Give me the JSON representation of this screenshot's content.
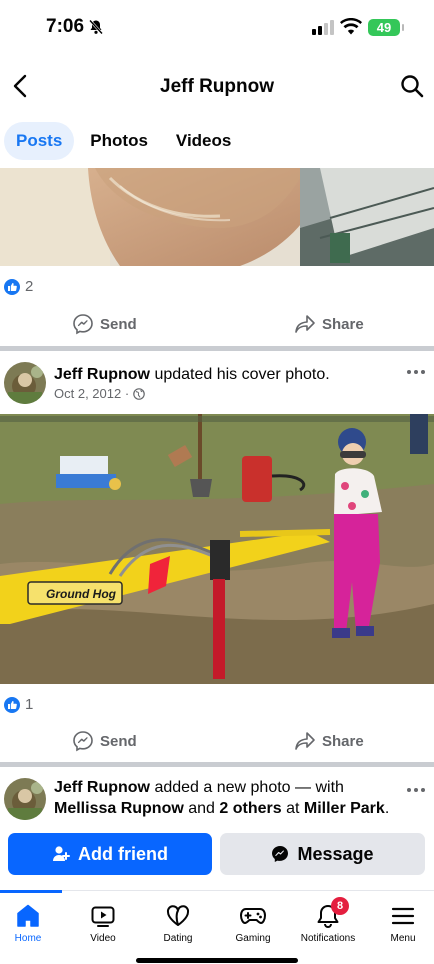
{
  "status_bar": {
    "time": "7:06",
    "battery": "49"
  },
  "header": {
    "title": "Jeff Rupnow"
  },
  "tabs": [
    {
      "label": "Posts",
      "active": true
    },
    {
      "label": "Photos",
      "active": false
    },
    {
      "label": "Videos",
      "active": false
    }
  ],
  "post1": {
    "reaction_count": "2",
    "send_label": "Send",
    "share_label": "Share"
  },
  "post2": {
    "author": "Jeff Rupnow",
    "action": " updated his cover photo.",
    "date": "Oct 2, 2012 ·",
    "photo_sign_text": "Ground Hog",
    "reaction_count": "1",
    "send_label": "Send",
    "share_label": "Share"
  },
  "post3": {
    "author": "Jeff Rupnow",
    "action_1": " added a new photo — with",
    "tagged": "Mellissa Rupnow",
    "and": " and ",
    "others": "2 others",
    "at": " at ",
    "place": "Miller Park",
    "end": "."
  },
  "cta": {
    "add_friend_label": "Add friend",
    "message_label": "Message"
  },
  "bottom_nav": [
    {
      "label": "Home",
      "icon": "home-icon",
      "active": true
    },
    {
      "label": "Video",
      "icon": "video-icon",
      "active": false
    },
    {
      "label": "Dating",
      "icon": "dating-icon",
      "active": false
    },
    {
      "label": "Gaming",
      "icon": "gaming-icon",
      "active": false
    },
    {
      "label": "Notifications",
      "icon": "bell-icon",
      "active": false,
      "badge": "8"
    },
    {
      "label": "Menu",
      "icon": "menu-icon",
      "active": false
    }
  ],
  "colors": {
    "brand_blue": "#0866ff",
    "tab_active_bg": "#e7f0fd",
    "badge_red": "#e41e3f",
    "muted_text": "#65676b"
  }
}
